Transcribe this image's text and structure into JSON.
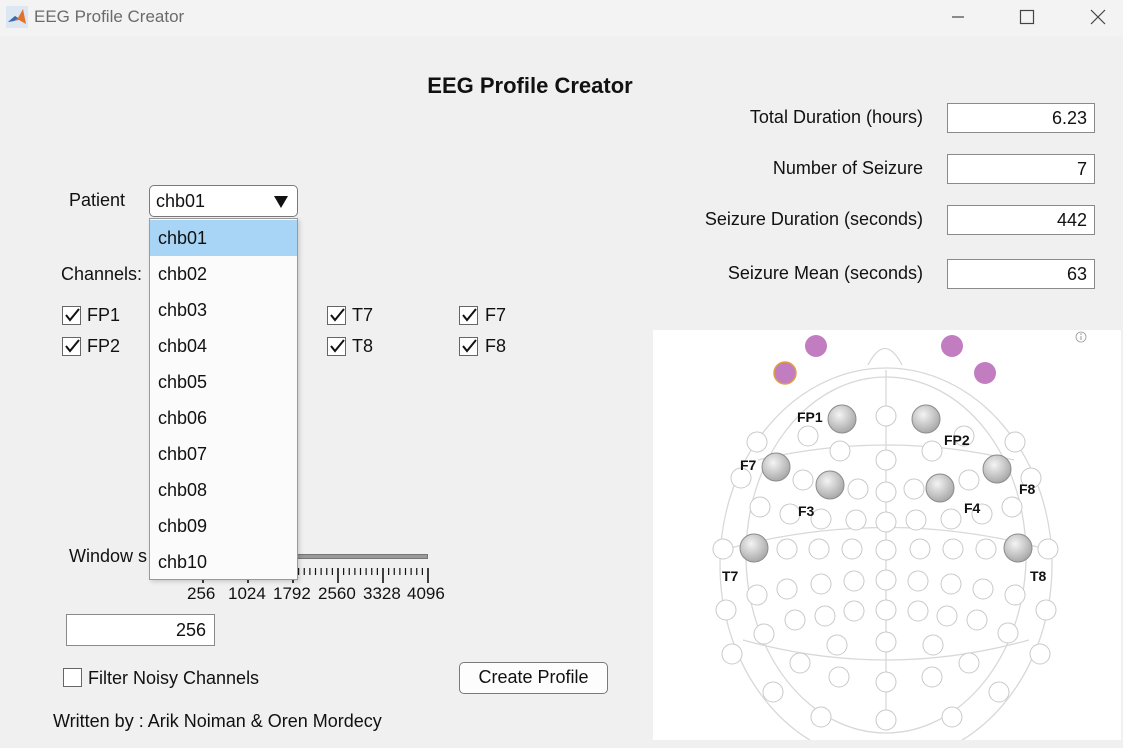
{
  "window": {
    "title": "EEG Profile Creator"
  },
  "main": {
    "title": "EEG Profile Creator"
  },
  "stats": [
    {
      "label": "Total Duration (hours)",
      "value": "6.23"
    },
    {
      "label": "Number of Seizure",
      "value": "7"
    },
    {
      "label": "Seizure Duration (seconds)",
      "value": "442"
    },
    {
      "label": "Seizure Mean (seconds)",
      "value": "63"
    }
  ],
  "patient": {
    "label": "Patient",
    "selected": "chb01",
    "options": [
      "chb01",
      "chb02",
      "chb03",
      "chb04",
      "chb05",
      "chb06",
      "chb07",
      "chb08",
      "chb09",
      "chb10"
    ]
  },
  "channels": {
    "label": "Channels:",
    "items": [
      {
        "name": "FP1",
        "checked": true
      },
      {
        "name": "FP2",
        "checked": true
      },
      {
        "name": "T7",
        "checked": true
      },
      {
        "name": "T8",
        "checked": true
      },
      {
        "name": "F7",
        "checked": true
      },
      {
        "name": "F8",
        "checked": true
      }
    ]
  },
  "window_size": {
    "label_visible": "Window s",
    "ticks": [
      "256",
      "1024",
      "1792",
      "2560",
      "3328",
      "4096"
    ],
    "value": "256"
  },
  "filter": {
    "label": "Filter Noisy Channels",
    "checked": false
  },
  "create_button": "Create Profile",
  "credits": "Written by : Arik Noiman & Oren Mordecy",
  "map": {
    "labels": [
      "FP1",
      "FP2",
      "F7",
      "F8",
      "F3",
      "F4",
      "T7",
      "T8"
    ],
    "colors": {
      "highlight": "#c27dc0",
      "electrode": "#cfcfcf",
      "outline": "#d8d8d8"
    }
  }
}
